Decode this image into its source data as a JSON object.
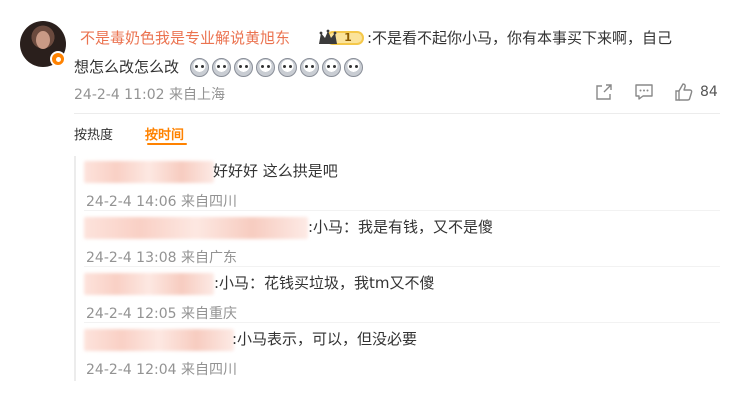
{
  "comment": {
    "username": "不是毒奶色我是专业解说黄旭东",
    "badge_level": "1",
    "text_line1": ":不是看不起你小马，你有本事买下来啊，自己",
    "text_line2": "想怎么改怎么改",
    "emoji_count": 8,
    "emoji_name": "crying-face-emoji",
    "timestamp": "24-2-4 11:02",
    "location": "来自上海",
    "like_count": "84"
  },
  "sort": {
    "by_hot": "按热度",
    "by_time": "按时间",
    "active": "按时间"
  },
  "replies": [
    {
      "text": "好好好 这么拱是吧",
      "timestamp": "24-2-4 14:06",
      "location": "来自四川"
    },
    {
      "text": ":小马：我是有钱，又不是傻",
      "timestamp": "24-2-4 13:08",
      "location": "来自广东"
    },
    {
      "text": ":小马：花钱买垃圾，我tm又不傻",
      "timestamp": "24-2-4 12:05",
      "location": "来自重庆"
    },
    {
      "text": ":小马表示，可以，但没必要",
      "timestamp": "24-2-4 12:04",
      "location": "来自四川"
    }
  ],
  "colors": {
    "accent": "#ff8200",
    "username": "#eb7350",
    "meta": "#939393",
    "body_text": "#333333"
  },
  "icons": [
    "share-icon",
    "comment-icon",
    "like-icon",
    "crown-badge-icon",
    "verified-badge-icon"
  ]
}
